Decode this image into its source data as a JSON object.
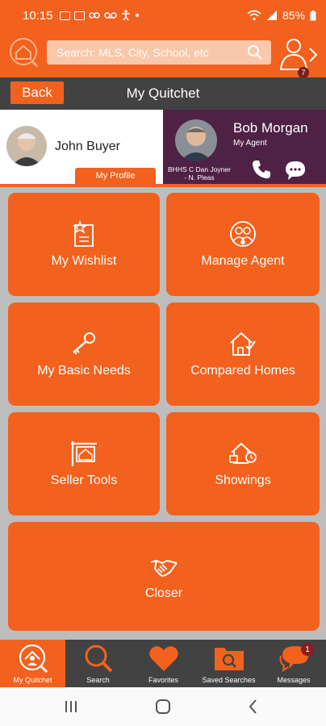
{
  "status_bar": {
    "time": "10:15",
    "battery": "85%"
  },
  "header": {
    "search_placeholder": "Search: MLS, City, School, etc",
    "agent_badge_count": "7"
  },
  "title_bar": {
    "back_label": "Back",
    "title": "My Quitchet"
  },
  "buyer": {
    "name": "John Buyer",
    "profile_button": "My Profile"
  },
  "agent": {
    "name": "Bob Morgan",
    "role": "My Agent",
    "office": "BHHS C Dan Joyner - N. Pleas"
  },
  "tiles": {
    "wishlist": "My Wishlist",
    "manage_agent": "Manage Agent",
    "basic_needs": "My Basic Needs",
    "compared_homes": "Compared Homes",
    "seller_tools": "Seller Tools",
    "showings": "Showings",
    "closer": "Closer"
  },
  "bottom_nav": {
    "my_quitchet": "My Quitchet",
    "search": "Search",
    "favorites": "Favorites",
    "saved_searches": "Saved Searches",
    "messages": "Messages",
    "messages_badge": "1"
  },
  "icons": {
    "status": [
      "gallery-icon",
      "gallery-icon",
      "game-icon",
      "voicemail-icon",
      "accessibility-icon",
      "dot-icon",
      "wifi-icon",
      "signal-icon",
      "battery-icon"
    ],
    "tiles": [
      "wishlist-icon",
      "manage-agent-icon",
      "key-icon",
      "compare-homes-icon",
      "for-sale-sign-icon",
      "showings-house-icon",
      "handshake-icon"
    ]
  },
  "colors": {
    "brand_orange": "#f2611d",
    "dark_gray": "#424242",
    "agent_purple": "#4f2145",
    "background_gray": "#bdbdbd",
    "badge_red": "#8b1c1c"
  }
}
